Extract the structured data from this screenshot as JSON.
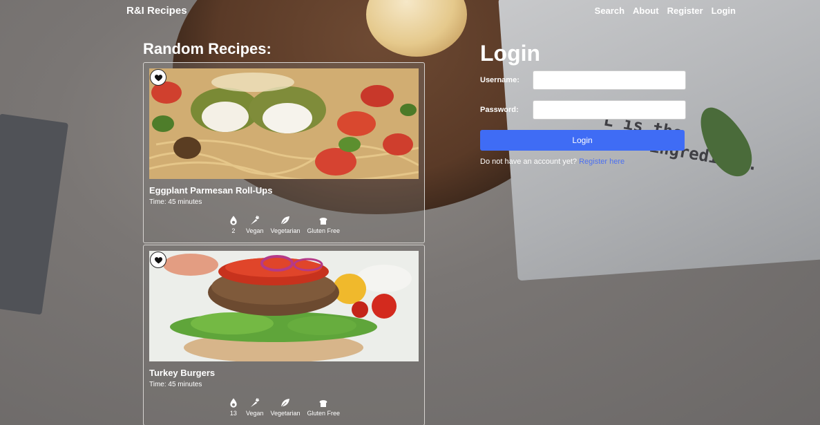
{
  "nav": {
    "brand": "R&I Recipes",
    "links": [
      "Search",
      "About",
      "Register",
      "Login"
    ]
  },
  "background": {
    "towel_text_line1": "L    is the",
    "towel_text_line2": "best ingredient."
  },
  "recipes_section": {
    "title": "Random Recipes:",
    "recipes": [
      {
        "name": "Eggplant Parmesan Roll-Ups",
        "time": "Time: 45 minutes",
        "likes": "2",
        "tags": [
          "Vegan",
          "Vegetarian",
          "Gluten Free"
        ]
      },
      {
        "name": "Turkey Burgers",
        "time": "Time: 45 minutes",
        "likes": "13",
        "tags": [
          "Vegan",
          "Vegetarian",
          "Gluten Free"
        ]
      }
    ]
  },
  "login": {
    "title": "Login",
    "username_label": "Username:",
    "password_label": "Password:",
    "button_label": "Login",
    "signup_prompt": "Do not have an account yet?",
    "signup_link": "Register here"
  },
  "colors": {
    "primary_button": "#3f6cf5",
    "link": "#4b6ff0"
  }
}
